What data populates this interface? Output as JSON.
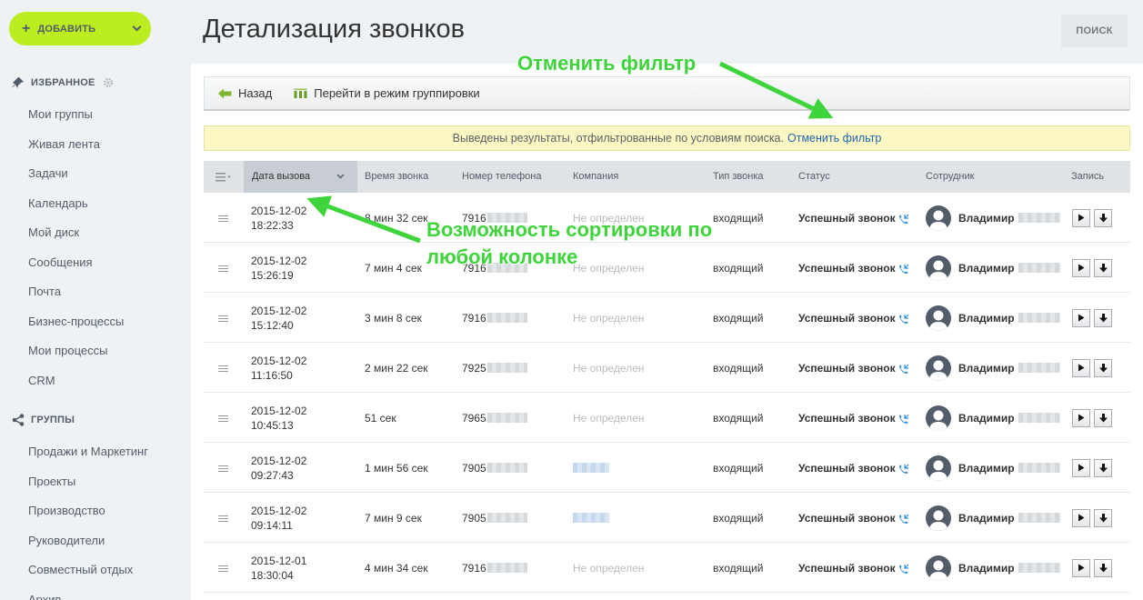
{
  "sidebar": {
    "add_label": "ДОБАВИТЬ",
    "favorites_title": "ИЗБРАННОЕ",
    "favorites": [
      "Мои группы",
      "Живая лента",
      "Задачи",
      "Календарь",
      "Мой диск",
      "Сообщения",
      "Почта",
      "Бизнес-процессы",
      "Мои процессы",
      "CRM"
    ],
    "groups_title": "ГРУППЫ",
    "groups": [
      "Продажи и Маркетинг",
      "Проекты",
      "Производство",
      "Руководители",
      "Совместный отдых",
      "Архив"
    ]
  },
  "header": {
    "title": "Детализация звонков",
    "search_label": "ПОИСК"
  },
  "toolbar": {
    "back_label": "Назад",
    "group_label": "Перейти в режим группировки"
  },
  "filter": {
    "text": "Выведены результаты, отфильтрованные по условиям поиска.",
    "cancel_label": "Отменить фильтр"
  },
  "table": {
    "columns": [
      "Дата вызова",
      "Время звонка",
      "Номер телефона",
      "Компания",
      "Тип звонка",
      "Статус",
      "Сотрудник",
      "Запись"
    ],
    "rows": [
      {
        "date": "2015-12-02",
        "time": "18:22:33",
        "duration": "8 мин 32 сек",
        "phone": "7916",
        "company": "Не определен",
        "company_known": false,
        "type": "входящий",
        "status": "Успешный звонок",
        "employee": "Владимир"
      },
      {
        "date": "2015-12-02",
        "time": "15:26:19",
        "duration": "7 мин 4 сек",
        "phone": "7916",
        "company": "Не определен",
        "company_known": false,
        "type": "входящий",
        "status": "Успешный звонок",
        "employee": "Владимир"
      },
      {
        "date": "2015-12-02",
        "time": "15:12:40",
        "duration": "3 мин 8 сек",
        "phone": "7916",
        "company": "Не определен",
        "company_known": false,
        "type": "входящий",
        "status": "Успешный звонок",
        "employee": "Владимир"
      },
      {
        "date": "2015-12-02",
        "time": "11:16:50",
        "duration": "2 мин 22 сек",
        "phone": "7925",
        "company": "Не определен",
        "company_known": false,
        "type": "входящий",
        "status": "Успешный звонок",
        "employee": "Владимир"
      },
      {
        "date": "2015-12-02",
        "time": "10:45:13",
        "duration": "51 сек",
        "phone": "7965",
        "company": "Не определен",
        "company_known": false,
        "type": "входящий",
        "status": "Успешный звонок",
        "employee": "Владимир"
      },
      {
        "date": "2015-12-02",
        "time": "09:27:43",
        "duration": "1 мин 56 сек",
        "phone": "7905",
        "company": "",
        "company_known": true,
        "type": "входящий",
        "status": "Успешный звонок",
        "employee": "Владимир"
      },
      {
        "date": "2015-12-02",
        "time": "09:14:11",
        "duration": "7 мин 9 сек",
        "phone": "7905",
        "company": "",
        "company_known": true,
        "type": "входящий",
        "status": "Успешный звонок",
        "employee": "Владимир"
      },
      {
        "date": "2015-12-01",
        "time": "18:30:04",
        "duration": "4 мин 34 сек",
        "phone": "7916",
        "company": "Не определен",
        "company_known": false,
        "type": "входящий",
        "status": "Успешный звонок",
        "employee": "Владимир"
      }
    ]
  },
  "annotations": {
    "cancel_filter": "Отменить фильтр",
    "sort_line1": "Возможность сортировки по",
    "sort_line2": "любой колонке"
  },
  "colors": {
    "add_button": "#bbed21",
    "annotation": "#3fd43c",
    "filter_bg": "#fcf8c4",
    "link": "#2067b0",
    "header_bg": "#dfe3e6"
  },
  "icons": {
    "back": "arrow-left-icon",
    "group": "grouping-icon",
    "call": "phone-incoming-icon",
    "play": "play-icon",
    "download": "download-icon"
  }
}
